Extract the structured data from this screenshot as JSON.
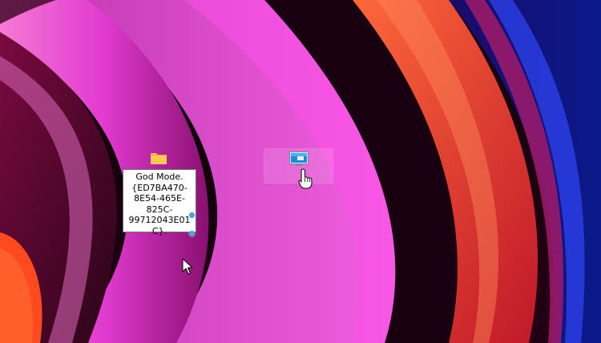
{
  "desktop": {
    "rename_text": "God Mode.\n{ED7BA470-\n8E54-465E-\n825C-\n99712043E01C}.",
    "icons": [
      {
        "name": "God Mode folder",
        "icon": "folder-icon",
        "state": "renaming"
      },
      {
        "name": "",
        "icon": "monitor-icon",
        "state": "hovered"
      }
    ]
  },
  "colors": {
    "wallpaper_base": "#120010",
    "magenta": "#e040d8",
    "pink": "#f070c8",
    "orange": "#f04a20",
    "blue": "#1030c0",
    "folder": "#f5c04a",
    "selection_dot": "#4aa3d8"
  },
  "cursors": [
    "arrow-cursor-icon",
    "hand-pointer-cursor-icon"
  ]
}
